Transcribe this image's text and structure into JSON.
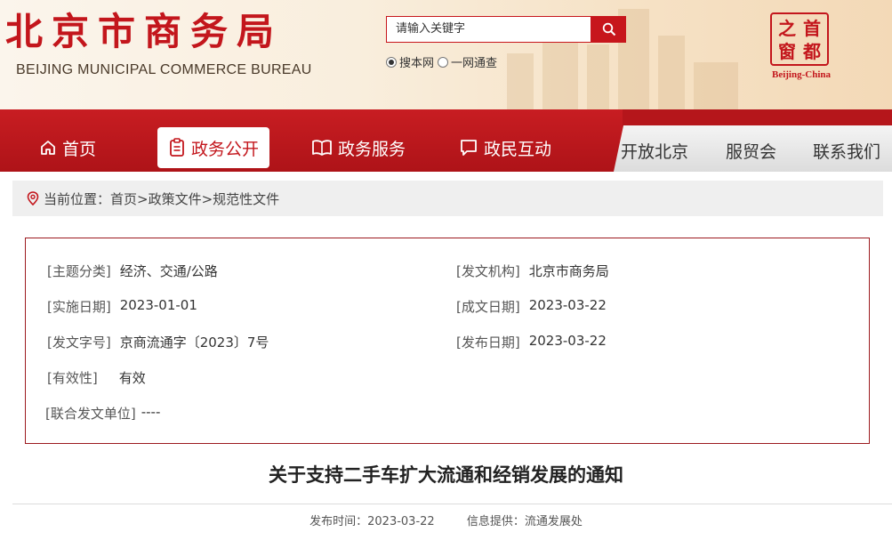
{
  "header": {
    "logo_cn": "北京市商务局",
    "logo_en": "BEIJING MUNICIPAL COMMERCE BUREAU",
    "search_placeholder": "请输入关键字",
    "search_scope_options": [
      {
        "label": "搜本网",
        "selected": true
      },
      {
        "label": "一网通查",
        "selected": false
      }
    ],
    "seal_chars": [
      "首",
      "都",
      "之",
      "窗"
    ],
    "seal_caption": "Beijing-China"
  },
  "nav": {
    "items": [
      {
        "label": "首页",
        "icon": "home-icon",
        "active": false
      },
      {
        "label": "政务公开",
        "icon": "document-icon",
        "active": true
      },
      {
        "label": "政务服务",
        "icon": "book-icon",
        "active": false
      },
      {
        "label": "政民互动",
        "icon": "chat-icon",
        "active": false
      }
    ],
    "secondary": [
      "开放北京",
      "服贸会",
      "联系我们"
    ]
  },
  "breadcrumb": {
    "text": "当前位置：首页>政策文件>规范性文件"
  },
  "info": {
    "topic_key": "[主题分类]",
    "topic_val": "经济、交通/公路",
    "issuer_key": "[发文机构]",
    "issuer_val": "北京市商务局",
    "effective_key": "[实施日期]",
    "effective_val": "2023-01-01",
    "written_key": "[成文日期]",
    "written_val": "2023-03-22",
    "docno_key": "[发文字号]",
    "docno_val": "京商流通字〔2023〕7号",
    "published_key": "[发布日期]",
    "published_val": "2023-03-22",
    "validity_key": "[有效性]",
    "validity_val": "有效",
    "joint_key": "[联合发文单位]",
    "joint_val": "----"
  },
  "article": {
    "title": "关于支持二手车扩大流通和经销发展的通知",
    "publish_time": "发布时间：2023-03-22",
    "provider": "信息提供：流通发展处"
  },
  "colors": {
    "brand_red": "#c3161c",
    "nav_red": "#b5161b",
    "border_red": "#9c1a1f"
  }
}
